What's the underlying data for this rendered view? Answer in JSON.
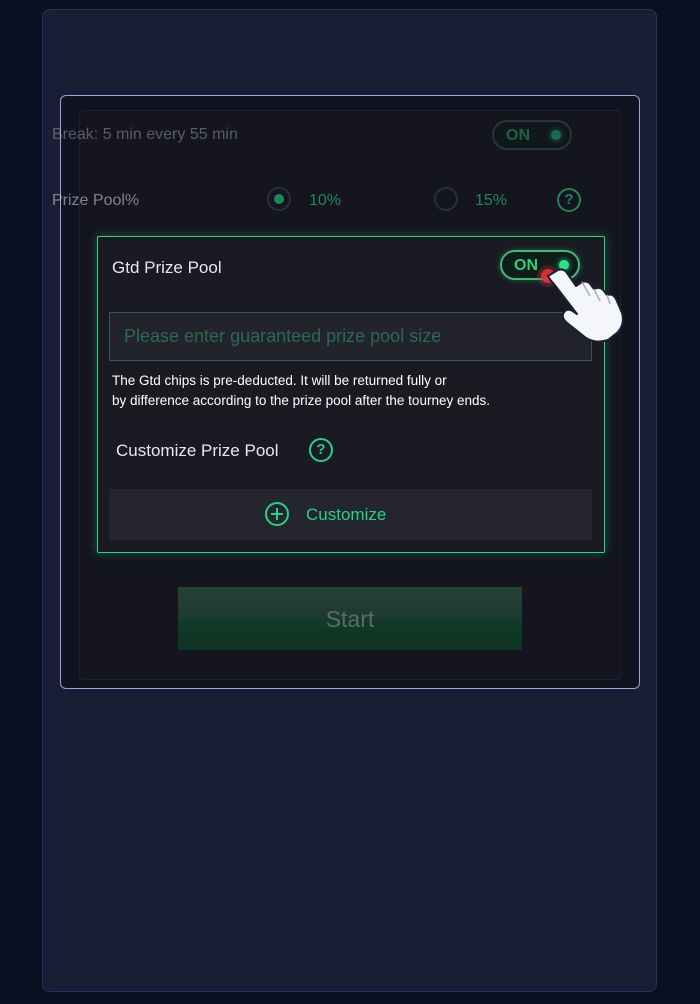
{
  "break_row": {
    "label": "Break: 5 min every 55 min",
    "toggle": "ON"
  },
  "prize_pool": {
    "label": "Prize Pool%",
    "options": [
      {
        "label": "10%",
        "selected": true
      },
      {
        "label": "15%",
        "selected": false
      }
    ],
    "help": "?"
  },
  "gtd": {
    "title": "Gtd Prize Pool",
    "toggle": "ON",
    "input_placeholder": "Please enter guaranteed prize pool size",
    "note_line1": "The Gtd chips is pre-deducted. It will be returned fully or",
    "note_line2": "by difference according to the prize pool after the tourney ends.",
    "customize_label": "Customize Prize Pool",
    "help": "?",
    "customize_button": "Customize"
  },
  "start_button": "Start",
  "colors": {
    "accent": "#2ad085",
    "background": "#0b0f22",
    "panel": "#1a1e35"
  },
  "icons": [
    "help-icon",
    "plus-circle-icon",
    "pointing-hand-icon"
  ]
}
